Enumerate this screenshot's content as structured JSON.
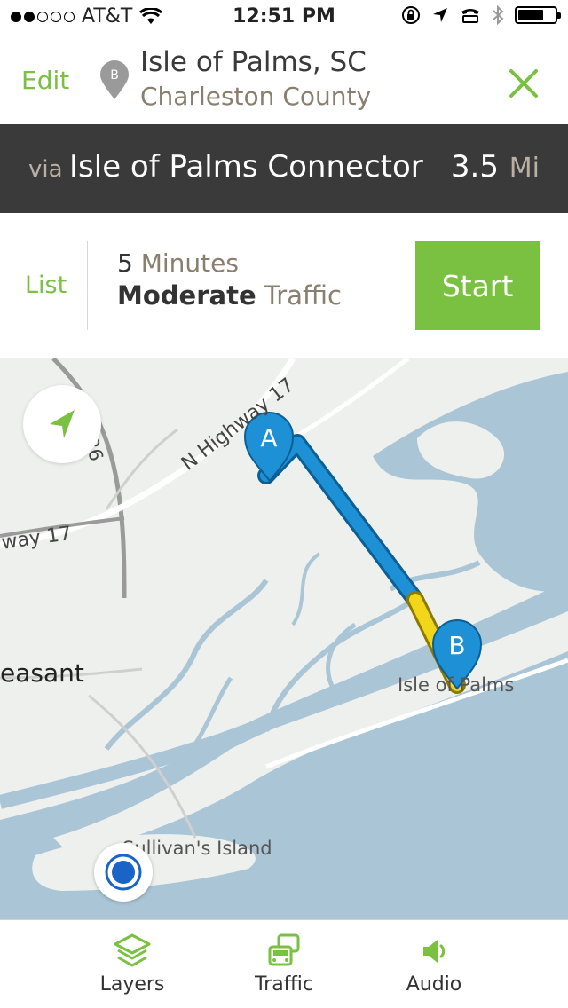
{
  "status_bar": {
    "carrier": "AT&T",
    "time": "12:51 PM",
    "signal_bars_filled": 2,
    "signal_bars_total": 5,
    "battery_level": 0.7
  },
  "header": {
    "edit_label": "Edit",
    "pin_letter": "B",
    "destination_name": "Isle of Palms, SC",
    "destination_county": "Charleston County"
  },
  "route": {
    "via_label": "via",
    "road_name": "Isle of Palms Connector",
    "distance": "3.5",
    "distance_unit": "Mi"
  },
  "summary": {
    "list_label": "List",
    "duration_value": "5",
    "duration_unit": "Minutes",
    "traffic_level": "Moderate",
    "traffic_word": "Traffic",
    "start_label": "Start"
  },
  "map": {
    "marker_a": "A",
    "marker_b": "B",
    "labels": {
      "i526": "I-526",
      "n_highway_17": "N Highway 17",
      "highway_17_left": "way 17",
      "mount_pleasant": "easant",
      "isle_of_palms": "Isle of Palms",
      "sullivans_island": "Sullivan's Island"
    },
    "colors": {
      "water": "#aac6d6",
      "land": "#eef0ed",
      "route_clear": "#1e90d6",
      "route_moderate": "#f2d619",
      "accent": "#7ac142"
    }
  },
  "tabs": [
    {
      "label": "Layers",
      "icon": "layers-icon"
    },
    {
      "label": "Traffic",
      "icon": "traffic-icon"
    },
    {
      "label": "Audio",
      "icon": "speaker-icon"
    }
  ]
}
